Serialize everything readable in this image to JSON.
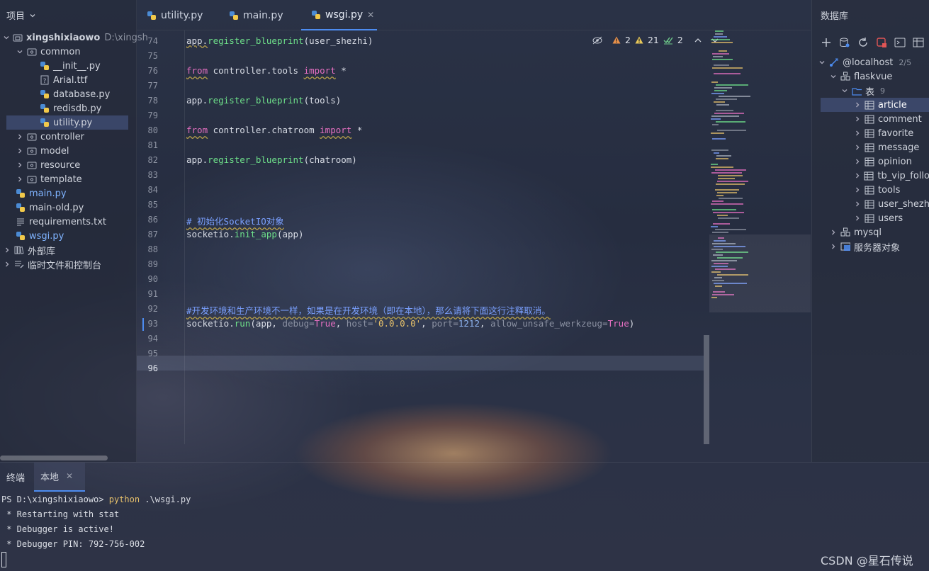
{
  "project": {
    "header_label": "项目",
    "root": {
      "name": "xingshixiaowo",
      "path": "D:\\xingsh"
    },
    "items": [
      {
        "label": "common",
        "type": "folder",
        "expanded": true
      },
      {
        "label": "__init__.py",
        "type": "py"
      },
      {
        "label": "Arial.ttf",
        "type": "unknown"
      },
      {
        "label": "database.py",
        "type": "py"
      },
      {
        "label": "redisdb.py",
        "type": "py"
      },
      {
        "label": "utility.py",
        "type": "py",
        "selected": true
      },
      {
        "label": "controller",
        "type": "folder"
      },
      {
        "label": "model",
        "type": "folder"
      },
      {
        "label": "resource",
        "type": "folder"
      },
      {
        "label": "template",
        "type": "folder"
      },
      {
        "label": "main.py",
        "type": "py"
      },
      {
        "label": "main-old.py",
        "type": "py"
      },
      {
        "label": "requirements.txt",
        "type": "txt"
      },
      {
        "label": "wsgi.py",
        "type": "py"
      },
      {
        "label": "外部库",
        "type": "lib"
      },
      {
        "label": "临时文件和控制台",
        "type": "scratch"
      }
    ]
  },
  "tabs": [
    {
      "label": "utility.py",
      "active": false
    },
    {
      "label": "main.py",
      "active": false
    },
    {
      "label": "wsgi.py",
      "active": true
    }
  ],
  "inspections": {
    "errors": "2",
    "warnings": "21",
    "ok": "2"
  },
  "editor": {
    "current_line": "96",
    "lines": [
      {
        "n": "74",
        "tokens": [
          {
            "t": "app.",
            "c": ""
          },
          {
            "t": "register_blueprint",
            "c": "fn"
          },
          {
            "t": "(user_shezhi)",
            "c": ""
          }
        ]
      },
      {
        "n": "75",
        "tokens": []
      },
      {
        "n": "76",
        "tokens": [
          {
            "t": "from",
            "c": "kw"
          },
          {
            "t": " controller.tools ",
            "c": ""
          },
          {
            "t": "import",
            "c": "kw"
          },
          {
            "t": " *",
            "c": ""
          }
        ]
      },
      {
        "n": "77",
        "tokens": []
      },
      {
        "n": "78",
        "tokens": [
          {
            "t": "app.",
            "c": ""
          },
          {
            "t": "register_blueprint",
            "c": "fn"
          },
          {
            "t": "(tools)",
            "c": ""
          }
        ]
      },
      {
        "n": "79",
        "tokens": []
      },
      {
        "n": "80",
        "tokens": [
          {
            "t": "from",
            "c": "kw"
          },
          {
            "t": " controller.chatroom ",
            "c": ""
          },
          {
            "t": "import",
            "c": "kw"
          },
          {
            "t": " *",
            "c": ""
          }
        ]
      },
      {
        "n": "81",
        "tokens": []
      },
      {
        "n": "82",
        "tokens": [
          {
            "t": "app.",
            "c": ""
          },
          {
            "t": "register_blueprint",
            "c": "fn"
          },
          {
            "t": "(chatroom)",
            "c": ""
          }
        ]
      },
      {
        "n": "83",
        "tokens": []
      },
      {
        "n": "84",
        "tokens": []
      },
      {
        "n": "85",
        "tokens": []
      },
      {
        "n": "86",
        "tokens": [
          {
            "t": "# 初始化SocketIO对象",
            "c": "cm"
          }
        ]
      },
      {
        "n": "87",
        "tokens": [
          {
            "t": "socketio.",
            "c": ""
          },
          {
            "t": "init_app",
            "c": "fn"
          },
          {
            "t": "(app)",
            "c": ""
          }
        ]
      },
      {
        "n": "88",
        "tokens": []
      },
      {
        "n": "89",
        "tokens": []
      },
      {
        "n": "90",
        "tokens": []
      },
      {
        "n": "91",
        "tokens": []
      },
      {
        "n": "92",
        "tokens": [
          {
            "t": "#开发环境和生产环境不一样，如果是在开发环境（即在本地），那么请将下面这行注释取消。",
            "c": "cm"
          }
        ]
      },
      {
        "n": "93",
        "tokens": [
          {
            "t": "socketio.",
            "c": ""
          },
          {
            "t": "run",
            "c": "fn"
          },
          {
            "t": "(app, ",
            "c": ""
          },
          {
            "t": "debug=",
            "c": "prm"
          },
          {
            "t": "True",
            "c": "tru"
          },
          {
            "t": ", ",
            "c": ""
          },
          {
            "t": "host=",
            "c": "prm"
          },
          {
            "t": "'0.0.0.0'",
            "c": "str"
          },
          {
            "t": ", ",
            "c": ""
          },
          {
            "t": "port=",
            "c": "prm"
          },
          {
            "t": "1212",
            "c": "num"
          },
          {
            "t": ", ",
            "c": ""
          },
          {
            "t": "allow_unsafe_werkzeug=",
            "c": "prm"
          },
          {
            "t": "True",
            "c": "tru"
          },
          {
            "t": ")",
            "c": ""
          }
        ]
      },
      {
        "n": "94",
        "tokens": []
      },
      {
        "n": "95",
        "tokens": []
      },
      {
        "n": "96",
        "tokens": []
      }
    ]
  },
  "database": {
    "header_label": "数据库",
    "host": {
      "label": "@localhost",
      "count": "2/5"
    },
    "schema": "flaskvue",
    "tables_folder": {
      "label": "表",
      "count": "9"
    },
    "tables": [
      "article",
      "comment",
      "favorite",
      "message",
      "opinion",
      "tb_vip_follo",
      "tools",
      "user_shezh",
      "users"
    ],
    "selected_table": "article",
    "other_schema": "mysql",
    "server_objects": "服务器对象"
  },
  "terminal": {
    "tab_title": "终端",
    "local_tab": "本地",
    "lines": [
      {
        "prompt": "PS D:\\xingshixiaowo> ",
        "cmd": "python",
        "arg": " .\\wsgi.py"
      },
      {
        "prompt": " * Restarting with stat",
        "cmd": "",
        "arg": ""
      },
      {
        "prompt": " * Debugger is active!",
        "cmd": "",
        "arg": ""
      },
      {
        "prompt": " * Debugger PIN: 792-756-002",
        "cmd": "",
        "arg": ""
      }
    ]
  },
  "watermark": "CSDN @星石传说"
}
